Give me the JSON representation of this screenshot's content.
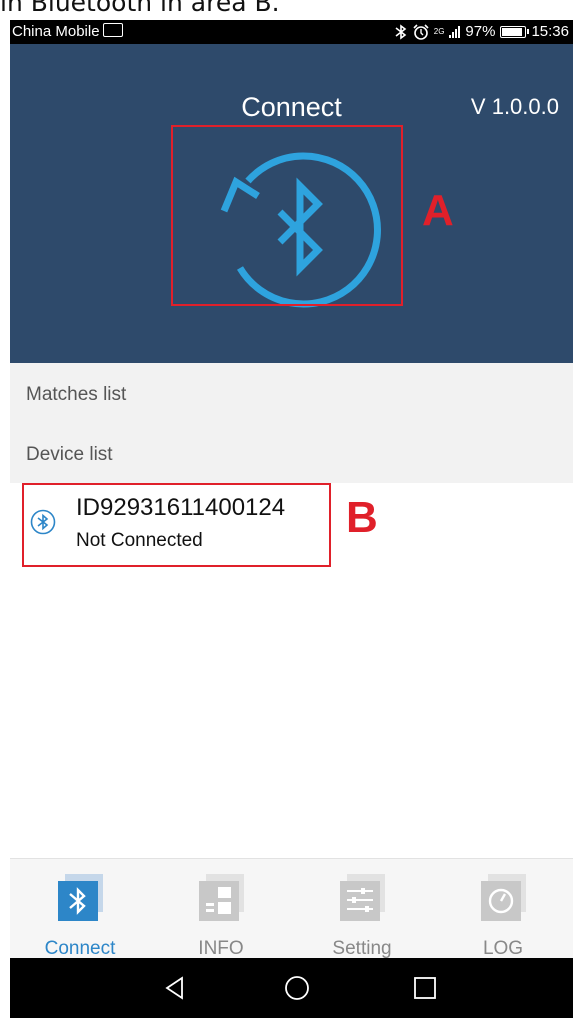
{
  "caption": "in Bluetooth in area B.",
  "status_bar": {
    "carrier": "China Mobile",
    "network": "2G",
    "battery": "97%",
    "time": "15:36"
  },
  "header": {
    "title": "Connect",
    "version": "V 1.0.0.0",
    "annotation_a": "A"
  },
  "sections": {
    "matches_label": "Matches list",
    "device_label": "Device list"
  },
  "device": {
    "id": "ID92931611400124",
    "status": "Not Connected",
    "annotation_b": "B"
  },
  "tabs": [
    {
      "label": "Connect",
      "icon": "bluetooth-icon",
      "active": true
    },
    {
      "label": "INFO",
      "icon": "info-icon",
      "active": false
    },
    {
      "label": "Setting",
      "icon": "settings-icon",
      "active": false
    },
    {
      "label": "LOG",
      "icon": "log-icon",
      "active": false
    }
  ],
  "colors": {
    "header_bg": "#2e4a6b",
    "accent": "#2d86c8",
    "annotation": "#e0202a"
  }
}
